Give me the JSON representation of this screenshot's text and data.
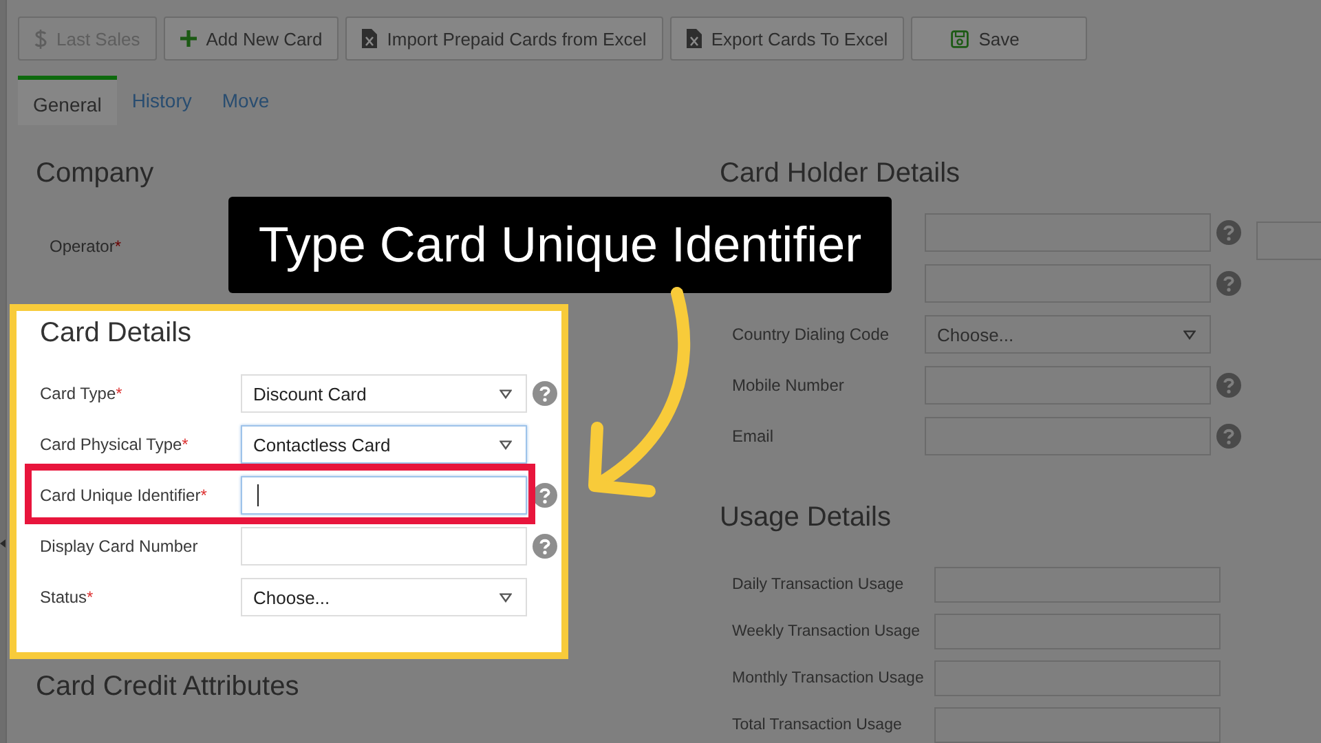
{
  "toolbar": [
    {
      "label": "Last Sales",
      "disabled": true
    },
    {
      "label": "Add New Card",
      "disabled": false
    },
    {
      "label": "Import Prepaid Cards from Excel",
      "disabled": false
    },
    {
      "label": "Export Cards To Excel",
      "disabled": false
    },
    {
      "label": "Save",
      "disabled": false
    }
  ],
  "tabs": [
    {
      "label": "General",
      "selected": true
    },
    {
      "label": "History",
      "selected": false
    },
    {
      "label": "Move",
      "selected": false
    }
  ],
  "company": {
    "title": "Company",
    "fields": [
      {
        "label": "Operator",
        "required_mark": "*"
      }
    ]
  },
  "card_details": {
    "title": "Card Details",
    "fields": [
      {
        "label": "Card Type",
        "required_mark": "*",
        "kind": "select",
        "value": "Discount Card",
        "help": true,
        "highlighted": false,
        "focused": false
      },
      {
        "label": "Card Physical Type",
        "required_mark": "*",
        "kind": "select",
        "value": "Contactless Card",
        "help": false,
        "highlighted": false,
        "focused": true
      },
      {
        "label": "Card Unique Identifier",
        "required_mark": "*",
        "kind": "input",
        "help": true,
        "highlighted": true,
        "focused": true
      },
      {
        "label": "Display Card Number",
        "kind": "input",
        "help": true,
        "highlighted": false,
        "focused": false
      },
      {
        "label": "Status",
        "required_mark": "*",
        "kind": "select",
        "value": "Choose...",
        "help": false,
        "highlighted": false,
        "focused": false
      }
    ]
  },
  "callout": {
    "text": "Type Card Unique Identifier"
  },
  "card_holder": {
    "title": "Card Holder Details",
    "fields": [
      {
        "kind": "input",
        "help": true,
        "extra_field": true
      },
      {
        "kind": "input",
        "help": true,
        "extra_field": false
      },
      {
        "label": "Country Dialing Code",
        "kind": "select",
        "value": "Choose...",
        "help": false,
        "extra_field": false
      },
      {
        "label": "Mobile Number",
        "kind": "input",
        "help": true,
        "extra_field": false
      },
      {
        "label": "Email",
        "kind": "input",
        "help": true,
        "extra_field": false
      }
    ]
  },
  "usage": {
    "title": "Usage Details",
    "fields": [
      {
        "label": "Daily Transaction Usage"
      },
      {
        "label": "Weekly Transaction Usage"
      },
      {
        "label": "Monthly Transaction Usage"
      },
      {
        "label": "Total Transaction Usage"
      }
    ]
  },
  "card_credit": {
    "title": "Card Credit Attributes"
  }
}
